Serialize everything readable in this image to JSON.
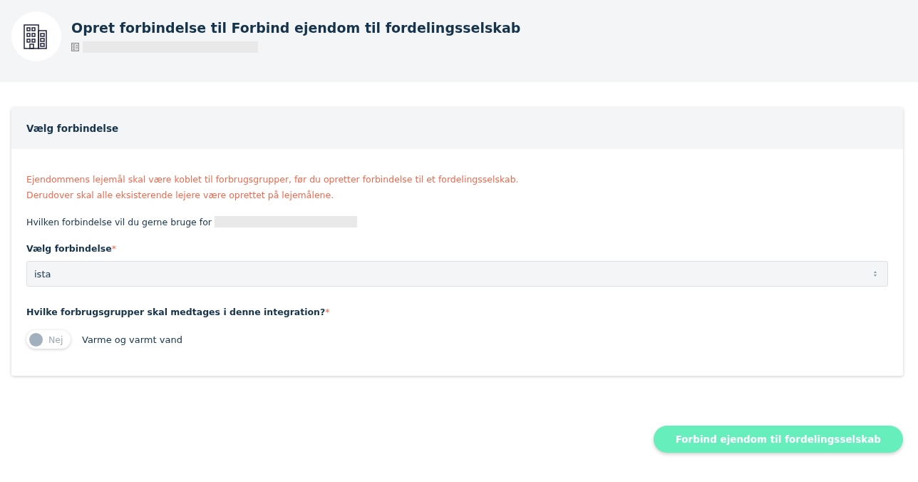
{
  "header": {
    "title": "Opret forbindelse til Forbind ejendom til fordelingsselskab"
  },
  "card": {
    "title": "Vælg forbindelse",
    "warning_lines": [
      "Ejendommens lejemål skal være koblet til forbrugsgrupper, før du opretter forbindelse til et fordelingsselskab.",
      "Derudover skal alle eksisterende lejere være oprettet på lejemålene."
    ],
    "question": "Hvilken forbindelse vil du gerne bruge for",
    "connection_field": {
      "label": "Vælg forbindelse",
      "required_mark": "*",
      "value": "ista"
    },
    "groups_field": {
      "label": "Hvilke forbrugsgrupper skal medtages i denne integration?",
      "required_mark": "*",
      "toggles": [
        {
          "on": false,
          "state_label": "Nej",
          "label": "Varme og varmt vand"
        }
      ]
    }
  },
  "submit_button": {
    "label": "Forbind ejendom til fordelingsselskab",
    "disabled": true
  }
}
